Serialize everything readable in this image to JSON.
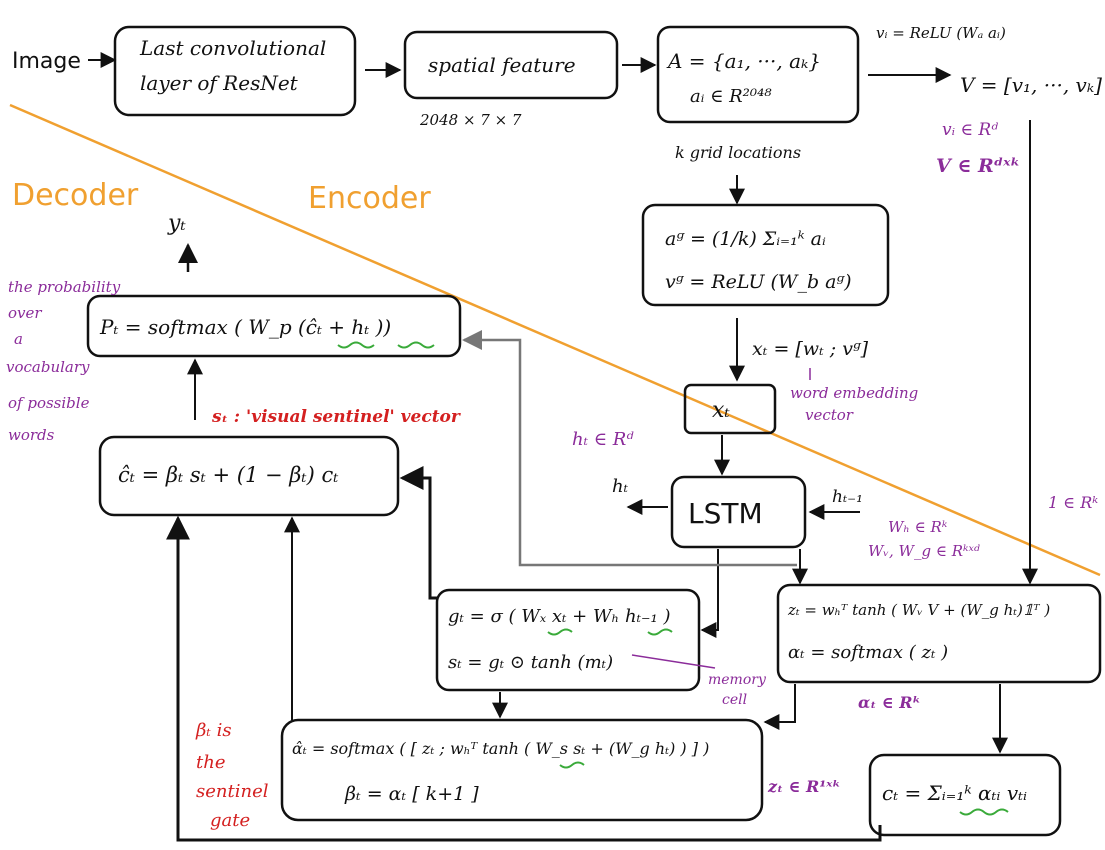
{
  "colors": {
    "ink": "#111111",
    "orange": "#f0a030",
    "purple": "#8b2c9a",
    "red": "#d42020",
    "gray": "#777777",
    "green": "#3aaa3a"
  },
  "labels": {
    "image": "Image",
    "resnet_line1": "Last convolutional",
    "resnet_line2": "layer of ResNet",
    "spatial": "spatial feature",
    "dims": "2048 × 7 × 7",
    "a_set": "A = {a₁, ···, aₖ}",
    "a_in": "aᵢ ∈ R²⁰⁴⁸",
    "grid": "k grid locations",
    "vi_relu": "vᵢ = ReLU (Wₐ aᵢ)",
    "V": "V = [v₁, ···, vₖ]",
    "vi_in": "vᵢ ∈ Rᵈ",
    "V_in": "V ∈ Rᵈˣᵏ",
    "ag": "aᵍ = (1/k) Σᵢ₌₁ᵏ aᵢ",
    "vg": "vᵍ = ReLU (W_b aᵍ)",
    "xt_def": "xₜ = [wₜ ; vᵍ]",
    "word_emb_1": "word embedding",
    "word_emb_2": "vector",
    "xt": "xₜ",
    "lstm": "LSTM",
    "ht_out": "hₜ",
    "htm1": "hₜ₋₁",
    "ht_in": "hₜ ∈ Rᵈ",
    "ones": "1 ∈ Rᵏ",
    "wh_in": "Wₕ ∈ Rᵏ",
    "wv_in": "Wᵥ, W_g ∈ Rᵏˣᵈ",
    "decoder": "Decoder",
    "encoder": "Encoder",
    "yt": "yₜ",
    "prob_1": "the probability",
    "prob_2": "over",
    "prob_3": "a",
    "prob_4": "vocabulary",
    "prob_5": "of possible",
    "prob_6": "words",
    "pt": "Pₜ = softmax ( W_p (ĉₜ + hₜ ))",
    "st_label": "sₜ : 'visual sentinel' vector",
    "ct_hat": "ĉₜ = βₜ sₜ + (1 − βₜ) cₜ",
    "gt": "gₜ = σ ( Wₓ xₜ + Wₕ hₜ₋₁ )",
    "st": "sₜ = gₜ ⊙ tanh (mₜ)",
    "memory_1": "memory",
    "memory_2": "cell",
    "zt": "zₜ = wₕᵀ tanh ( Wᵥ V + (W_g hₜ)𝟙ᵀ )",
    "alpha": "αₜ = softmax ( zₜ )",
    "alpha_in": "αₜ ∈ Rᵏ",
    "alpha_hat": "α̂ₜ = softmax ( [ zₜ ; wₕᵀ tanh ( W_s sₜ + (W_g hₜ) ) ] )",
    "beta": "βₜ = αₜ [ k+1 ]",
    "zt_in": "zₜ ∈ R¹ˣᵏ",
    "beta_note_1": "βₜ is",
    "beta_note_2": "the",
    "beta_note_3": "sentinel",
    "beta_note_4": "gate",
    "ct": "cₜ = Σᵢ₌₁ᵏ αₜᵢ vₜᵢ"
  }
}
